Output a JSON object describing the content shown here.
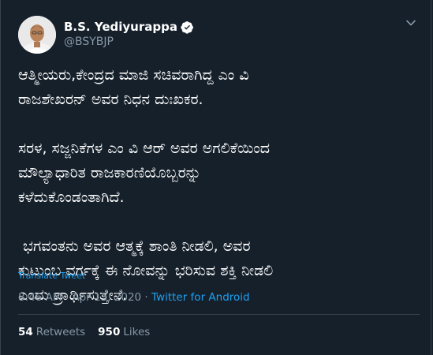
{
  "tweet": {
    "author_name": "B.S. Yediyurappa",
    "handle": "@BSYBJP",
    "text": "ಆತ್ಮೀಯರು,ಕೇಂದ್ರದ ಮಾಜಿ ಸಚಿವರಾಗಿದ್ದ ಎಂ ವಿ\nರಾಜಶೇಖರನ್ ಅವರ ನಿಧನ ದುಃಖಕರ.\n\nಸರಳ, ಸಜ್ಜನಿಕೆಗಳ ಎಂ ವಿ ಆರ್ ಅವರ ಅಗಲಿಕೆಯಿಂದ\nಮೌಲ್ಯಾಧಾರಿತ ರಾಜಕಾರಣಿಯೊಬ್ಬರನ್ನು\nಕಳೆದುಕೊಂಡಂತಾಗಿದೆ.\n\n ಭಗವಂತನು ಅವರ ಆತ್ಮಕ್ಕೆ ಶಾಂತಿ ನೀಡಲಿ, ಅವರ\nಕುಟುಂಬ ವರ್ಗಕ್ಕೆ ಈ ನೋವನ್ನು ಭರಿಸುವ ಶಕ್ತಿ ನೀಡಲಿ\nಎಂದು ಪ್ರಾರ್ಥಿಸುತ್ತೇನೆ.",
    "translate_label": "Translate Tweet",
    "timestamp": "8:46 AM · Apr 13, 2020 · ",
    "source": "Twitter for Android",
    "retweets_count": "54",
    "retweets_label": "Retweets",
    "likes_count": "950",
    "likes_label": "Likes"
  },
  "icons": {
    "verified": "verified-badge-icon",
    "menu": "chevron-down-icon"
  },
  "colors": {
    "background": "#15202b",
    "accent": "#1da1f2",
    "muted": "#8899a6",
    "border": "#38444d"
  }
}
